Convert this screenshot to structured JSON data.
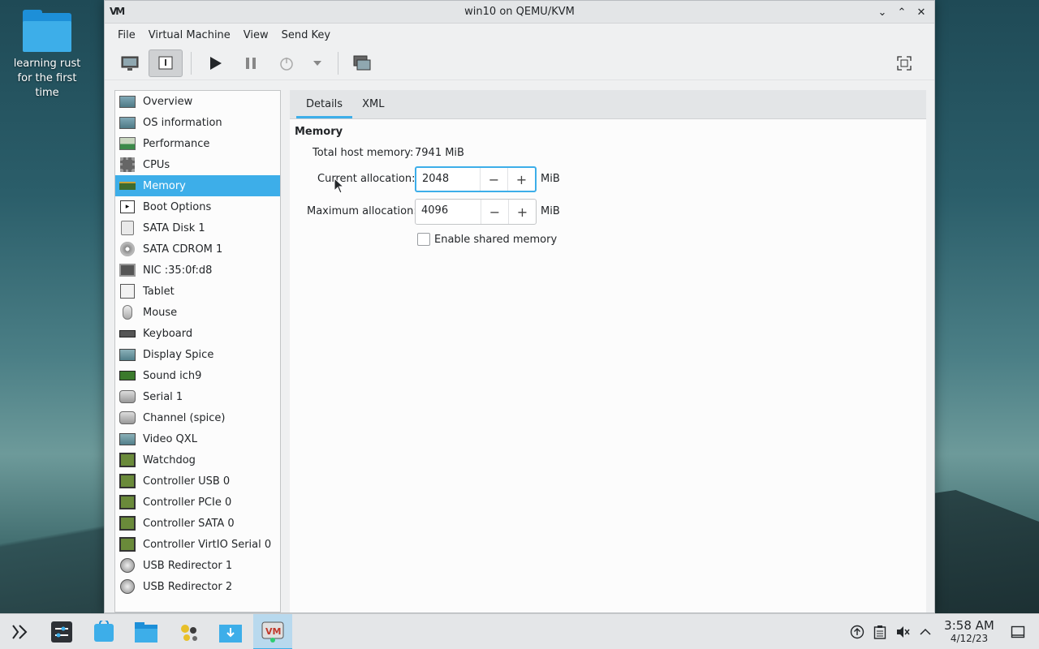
{
  "desktop": {
    "folder_label": "learning rust for the first time"
  },
  "window": {
    "title": "win10 on QEMU/KVM",
    "app_icon": "VM",
    "buttons": {
      "minimize": "⌄",
      "maximize": "⌃",
      "close": "✕"
    }
  },
  "menu": [
    "File",
    "Virtual Machine",
    "View",
    "Send Key"
  ],
  "toolbar": {
    "console_icon": "monitor-icon",
    "details_icon": "info-icon",
    "run_icon": "play-icon",
    "pause_icon": "pause-icon",
    "shutdown_icon": "power-icon",
    "shutdown_menu_icon": "chevron-down-icon",
    "snapshots_icon": "snapshots-icon",
    "fullscreen_icon": "fullscreen-icon"
  },
  "sidebar": {
    "selected": "Memory",
    "items": [
      {
        "label": "Overview",
        "icon": "monitor"
      },
      {
        "label": "OS information",
        "icon": "monitor"
      },
      {
        "label": "Performance",
        "icon": "chart"
      },
      {
        "label": "CPUs",
        "icon": "chip"
      },
      {
        "label": "Memory",
        "icon": "mem"
      },
      {
        "label": "Boot Options",
        "icon": "term"
      },
      {
        "label": "SATA Disk 1",
        "icon": "disk"
      },
      {
        "label": "SATA CDROM 1",
        "icon": "cd"
      },
      {
        "label": "NIC :35:0f:d8",
        "icon": "nic"
      },
      {
        "label": "Tablet",
        "icon": "tablet"
      },
      {
        "label": "Mouse",
        "icon": "mouse"
      },
      {
        "label": "Keyboard",
        "icon": "kbd"
      },
      {
        "label": "Display Spice",
        "icon": "display"
      },
      {
        "label": "Sound ich9",
        "icon": "sound"
      },
      {
        "label": "Serial 1",
        "icon": "serial"
      },
      {
        "label": "Channel (spice)",
        "icon": "serial"
      },
      {
        "label": "Video QXL",
        "icon": "display"
      },
      {
        "label": "Watchdog",
        "icon": "ctrl"
      },
      {
        "label": "Controller USB 0",
        "icon": "ctrl"
      },
      {
        "label": "Controller PCIe 0",
        "icon": "ctrl"
      },
      {
        "label": "Controller SATA 0",
        "icon": "ctrl"
      },
      {
        "label": "Controller VirtIO Serial 0",
        "icon": "ctrl"
      },
      {
        "label": "USB Redirector 1",
        "icon": "usb"
      },
      {
        "label": "USB Redirector 2",
        "icon": "usb"
      }
    ]
  },
  "details": {
    "tabs": [
      "Details",
      "XML"
    ],
    "active_tab": "Details",
    "section_title": "Memory",
    "total_host_memory_label": "Total host memory:",
    "total_host_memory_value": "7941 MiB",
    "current_allocation_label": "Current allocation:",
    "current_allocation_value": "2048",
    "maximum_allocation_label": "Maximum allocation:",
    "maximum_allocation_value": "4096",
    "unit": "MiB",
    "minus": "−",
    "plus": "+",
    "shared_memory_label": "Enable shared memory",
    "shared_memory_checked": false
  },
  "taskbar": {
    "items": [
      "app-launcher-icon",
      "system-settings-icon",
      "discover-icon",
      "dolphin-icon",
      "krita-icon",
      "downloads-icon",
      "virt-manager-icon"
    ],
    "clock_time": "3:58 AM",
    "clock_date": "4/12/23"
  },
  "colors": {
    "accent": "#3daee9",
    "window_bg": "#eff0f1"
  }
}
